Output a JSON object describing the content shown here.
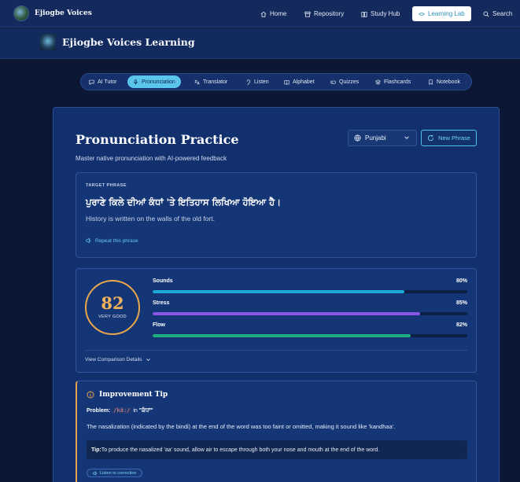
{
  "app": {
    "brand": "Ejiogbe Voices"
  },
  "topnav": {
    "items": [
      {
        "label": "Home",
        "icon": "home-icon"
      },
      {
        "label": "Repository",
        "icon": "archive-icon"
      },
      {
        "label": "Study Hub",
        "icon": "book-icon"
      },
      {
        "label": "Learning Lab",
        "icon": "flask-icon",
        "active": true
      },
      {
        "label": "Search",
        "icon": "search-icon"
      }
    ]
  },
  "subheader": {
    "title": "Ejiogbe Voices Learning"
  },
  "tabs": [
    {
      "label": "AI Tutor",
      "icon": "chat-icon"
    },
    {
      "label": "Pronunciation",
      "icon": "mic-icon",
      "active": true
    },
    {
      "label": "Translator",
      "icon": "translate-icon"
    },
    {
      "label": "Listen",
      "icon": "ear-icon"
    },
    {
      "label": "Alphabet",
      "icon": "book-open-icon"
    },
    {
      "label": "Quizzes",
      "icon": "gamepad-icon"
    },
    {
      "label": "Flashcards",
      "icon": "layers-icon"
    },
    {
      "label": "Notebook",
      "icon": "bookmark-icon"
    }
  ],
  "practice": {
    "title": "Pronunciation Practice",
    "subtitle": "Master native pronunciation with AI-powered feedback",
    "language": "Punjabi",
    "new_phrase_label": "New Phrase"
  },
  "target": {
    "label": "TARGET PHRASE",
    "phrase": "ਪੁਰਾਣੇ ਕਿਲੇ ਦੀਆਂ ਕੰਧਾਂ 'ਤੇ ਇਤਿਹਾਸ ਲਿਖਿਆ ਹੋਇਆ ਹੈ।",
    "translation": "History is written on the walls of the old fort.",
    "repeat_label": "Repeat this phrase"
  },
  "score": {
    "value": "82",
    "rating": "VERY GOOD",
    "metrics": [
      {
        "name": "Sounds",
        "value": "80%",
        "fraction": 0.8,
        "color": "#1fa9d6"
      },
      {
        "name": "Stress",
        "value": "85%",
        "fraction": 0.85,
        "color": "#8b57e6"
      },
      {
        "name": "Flow",
        "value": "82%",
        "fraction": 0.82,
        "color": "#1fb07e"
      }
    ],
    "compare_label": "View Comparison Details"
  },
  "tip": {
    "title": "Improvement Tip",
    "problem_label": "Problem:",
    "problem_code": "/kã:/",
    "problem_in": "in",
    "problem_word": "\"ਕੰਧਾਂ\"",
    "description": "The nasalization (indicated by the bindi) at the end of the word was too faint or omitted, making it sound like 'kandhaa'.",
    "hint_label": "Tip:",
    "hint_text": "To produce the nasalized 'aa' sound, allow air to escape through both your nose and mouth at the end of the word.",
    "listen_label": "Listen to correction"
  },
  "colors": {
    "accent": "#5bc6ec",
    "score_gold": "#f2b35a",
    "tip_border": "#e5a44a"
  }
}
